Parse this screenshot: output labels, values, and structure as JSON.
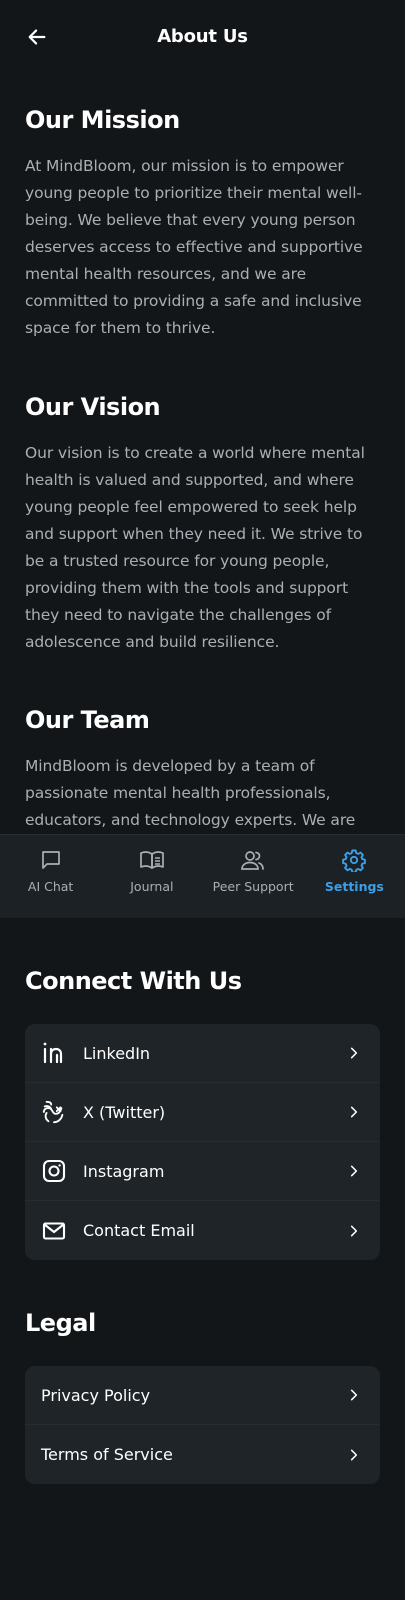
{
  "header": {
    "title": "About Us",
    "back_icon": "arrow-left-icon"
  },
  "sections": [
    {
      "title": "Our Mission",
      "body": "At MindBloom, our mission is to empower young people to prioritize their mental well-being. We believe that every young person deserves access to effective and supportive mental health resources, and we are committed to providing a safe and inclusive space for them to thrive."
    },
    {
      "title": "Our Vision",
      "body": "Our vision is to create a world where mental health is valued and supported, and where young people feel empowered to seek help and support when they need it. We strive to be a trusted resource for young people, providing them with the tools and support they need to navigate the challenges of adolescence and build resilience."
    },
    {
      "title": "Our Team",
      "body": "MindBloom is developed by a team of passionate mental health professionals, educators, and technology experts. We are"
    }
  ],
  "nav": {
    "items": [
      {
        "label": "AI Chat",
        "icon": "chat-bubble-icon"
      },
      {
        "label": "Journal",
        "icon": "book-icon"
      },
      {
        "label": "Peer Support",
        "icon": "people-icon"
      },
      {
        "label": "Settings",
        "icon": "gear-icon"
      }
    ],
    "active": "Settings",
    "active_color": "#3aa0ea"
  },
  "connect": {
    "title": "Connect With Us",
    "items": [
      {
        "label": "LinkedIn",
        "icon": "linkedin-icon"
      },
      {
        "label": "X (Twitter)",
        "icon": "twitter-x-icon"
      },
      {
        "label": "Instagram",
        "icon": "instagram-icon"
      },
      {
        "label": "Contact Email",
        "icon": "mail-icon"
      }
    ]
  },
  "legal": {
    "title": "Legal",
    "items": [
      {
        "label": "Privacy Policy"
      },
      {
        "label": "Terms of Service"
      }
    ]
  },
  "colors": {
    "background": "#121618",
    "card": "#1e2428",
    "nav": "#1b2125",
    "muted_text": "#a9afb4"
  }
}
